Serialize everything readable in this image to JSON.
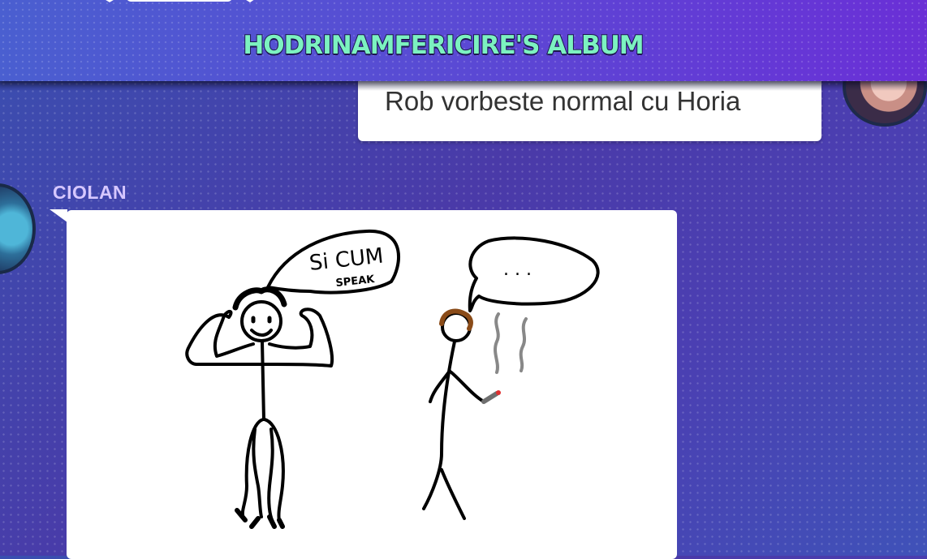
{
  "header": {
    "title": "HODRINAMFERICIRE'S ALBUM"
  },
  "messages": [
    {
      "direction": "sent",
      "text": "Rob vorbeste normal cu Horia"
    },
    {
      "direction": "received",
      "username": "CIOLAN",
      "attachment": {
        "type": "drawing",
        "texts": {
          "speech_left": "Si CUM",
          "speech_left_small": "SPEAK",
          "speech_right": ". . ."
        }
      }
    }
  ],
  "colors": {
    "title_fill": "#7cf2c0",
    "title_stroke": "#1d1550",
    "username": "#d6c7ff",
    "bubble": "#ffffff"
  }
}
